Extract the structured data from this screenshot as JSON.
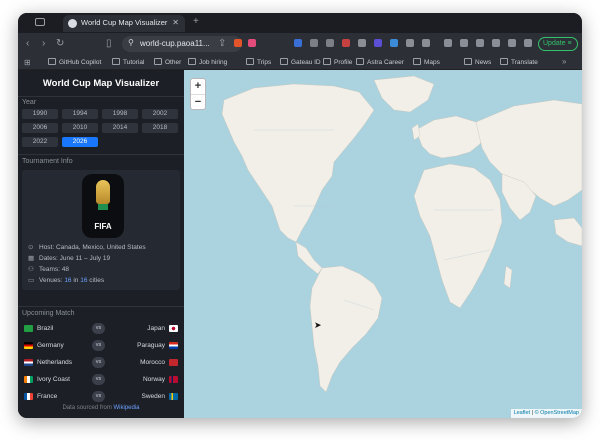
{
  "browser": {
    "tab_title": "World Cup Map Visualizer",
    "url": "world-cup.paoa11...",
    "update_label": "Update",
    "bookmarks": [
      "GitHub Copilot",
      "Tutorial",
      "Other",
      "Job hiring",
      "Trips",
      "Gateau ID",
      "Profile",
      "Astra Career",
      "Maps",
      "News",
      "Translate"
    ]
  },
  "app": {
    "title": "World Cup Map Visualizer",
    "year_label": "Year",
    "years": [
      "1990",
      "1994",
      "1998",
      "2002",
      "2006",
      "2010",
      "2014",
      "2018",
      "2022",
      "2026"
    ],
    "selected_year": "2026",
    "tournament_info_label": "Tournament Info",
    "logo_text": "FIFA",
    "host": "Host: Canada, Mexico, United States",
    "dates": "Dates: June 11 – July 19",
    "teams": "Teams: 48",
    "venues_prefix": "Venues:",
    "venues_count": "16",
    "venues_mid": "in",
    "cities_count": "16",
    "venues_suffix": "cities",
    "upcoming_match_label": "Upcoming Match",
    "vs_label": "vs",
    "matches": [
      {
        "home": "Brazil",
        "away": "Japan"
      },
      {
        "home": "Germany",
        "away": "Paraguay"
      },
      {
        "home": "Netherlands",
        "away": "Morocco"
      },
      {
        "home": "Ivory Coast",
        "away": "Norway"
      },
      {
        "home": "France",
        "away": "Sweden"
      }
    ],
    "footer_prefix": "Data sourced from",
    "footer_link": "Wikipedia"
  },
  "map": {
    "zoom_in": "+",
    "zoom_out": "−",
    "attribution_leaflet": "Leaflet",
    "attribution_sep": "|",
    "attribution_osm": "© OpenStreetMap"
  },
  "colors": {
    "accent": "#1976ff",
    "ocean": "#aad3df",
    "land": "#f2efe9",
    "sidebar_bg": "#1c1f26"
  }
}
